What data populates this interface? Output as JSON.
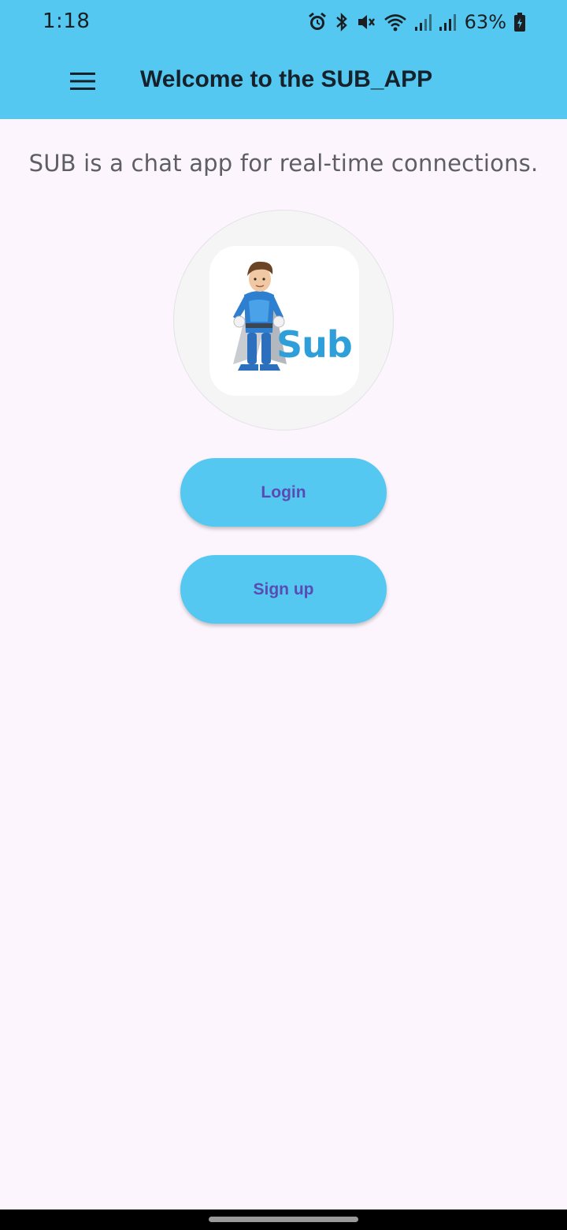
{
  "status_bar": {
    "time": "1:18",
    "battery_percent": "63%",
    "icons": [
      "alarm-icon",
      "bluetooth-icon",
      "mute-icon",
      "wifi-icon",
      "signal-icon",
      "signal-icon",
      "battery-charging-icon"
    ]
  },
  "app_bar": {
    "title": "Welcome to the SUB_APP",
    "menu_icon": "hamburger-menu-icon"
  },
  "main": {
    "tagline": "SUB is a chat app for real-time connections.",
    "logo": {
      "text": "Sub",
      "icon": "superhero-mascot-logo"
    },
    "buttons": {
      "login_label": "Login",
      "signup_label": "Sign up"
    }
  },
  "colors": {
    "accent": "#54c8f0",
    "button_text": "#5a4bb3",
    "background": "#fcf5fd",
    "title_text": "#16222b"
  }
}
